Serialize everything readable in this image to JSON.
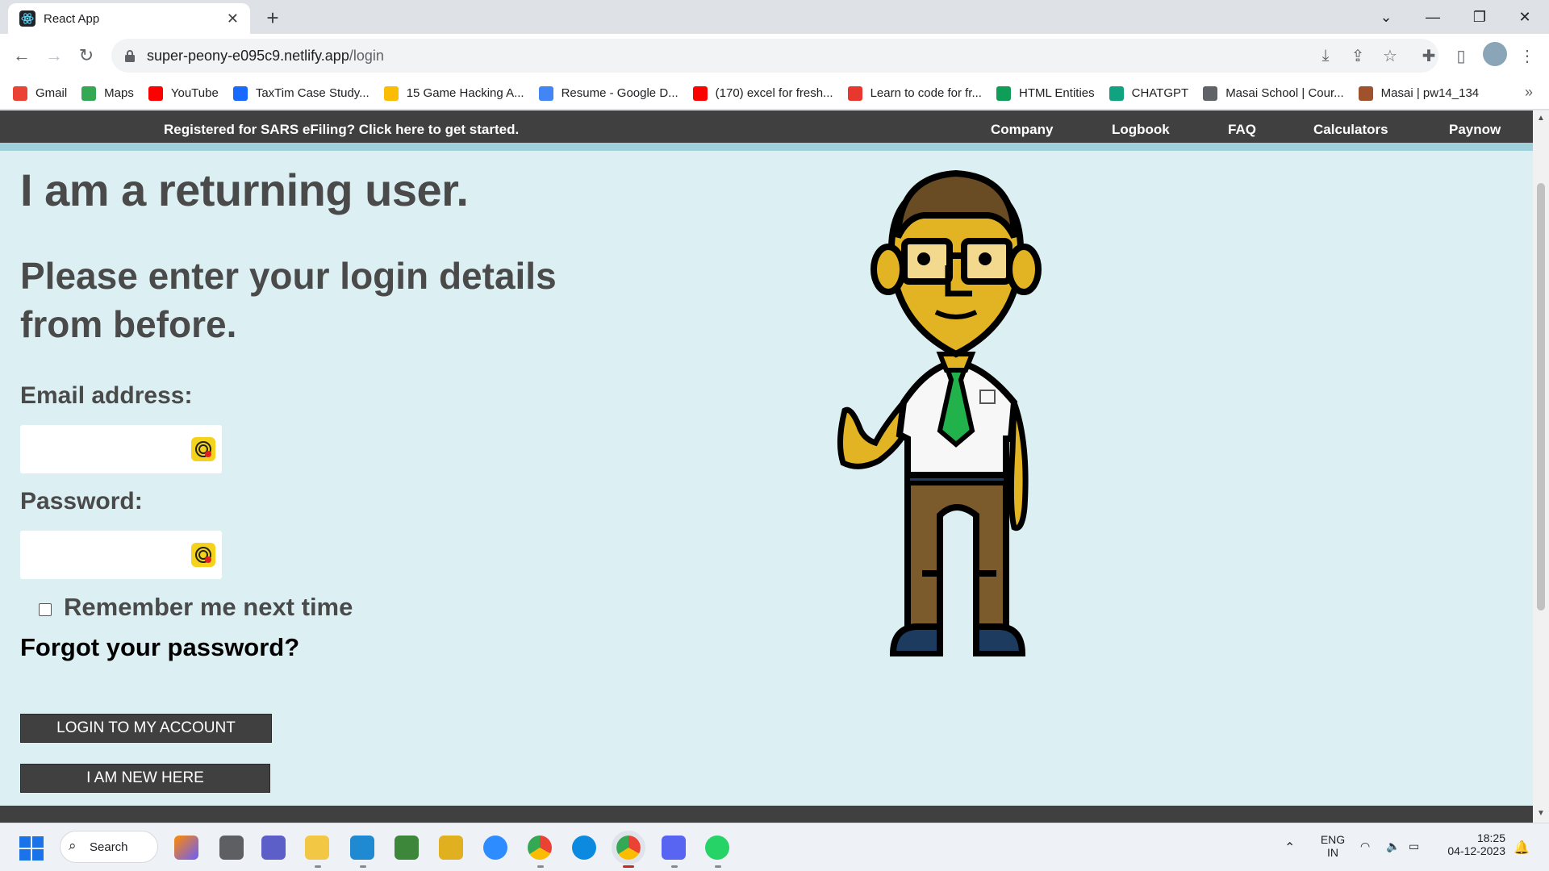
{
  "browser": {
    "tab_title": "React App",
    "url_host": "super-peony-e095c9.netlify.app",
    "url_path": "/login",
    "bookmarks": [
      {
        "label": "Gmail",
        "icon": "gmail-icon",
        "color": "#ea4335"
      },
      {
        "label": "Maps",
        "icon": "maps-icon",
        "color": "#34a853"
      },
      {
        "label": "YouTube",
        "icon": "youtube-icon",
        "color": "#ff0000"
      },
      {
        "label": "TaxTim Case Study...",
        "icon": "behance-icon",
        "color": "#1769ff"
      },
      {
        "label": "15 Game Hacking A...",
        "icon": "drive-icon",
        "color": "#fbbc04"
      },
      {
        "label": "Resume - Google D...",
        "icon": "docs-icon",
        "color": "#4285f4"
      },
      {
        "label": "(170) excel for fresh...",
        "icon": "youtube-icon",
        "color": "#ff0000"
      },
      {
        "label": "Learn to code for fr...",
        "icon": "codecademy-icon",
        "color": "#e8372e"
      },
      {
        "label": "HTML Entities",
        "icon": "w3-icon",
        "color": "#0f9d58"
      },
      {
        "label": "CHATGPT",
        "icon": "openai-icon",
        "color": "#10a37f"
      },
      {
        "label": "Masai School | Cour...",
        "icon": "globe-icon",
        "color": "#5f6368"
      },
      {
        "label": "Masai | pw14_134",
        "icon": "pin-icon",
        "color": "#a0522d"
      }
    ]
  },
  "site": {
    "promo": "Registered for SARS eFiling? Click here to get started.",
    "nav": [
      "Company",
      "Logbook",
      "FAQ",
      "Calculators",
      "Paynow"
    ]
  },
  "login": {
    "heading": "I am a returning user.",
    "subheading": "Please enter your login details from before.",
    "email_label": "Email address:",
    "email_value": "",
    "password_label": "Password:",
    "password_value": "",
    "remember_label": "Remember me next time",
    "remember_checked": false,
    "forgot_label": "Forgot your password?",
    "login_button": "LOGIN TO MY ACCOUNT",
    "new_button": "I AM NEW HERE"
  },
  "taskbar": {
    "search_label": "Search",
    "lang_top": "ENG",
    "lang_bottom": "IN",
    "time": "18:25",
    "date": "04-12-2023"
  },
  "colors": {
    "page_bg": "#dcf0f4",
    "dark_bar": "#404041",
    "accent_stripe": "#9fd0dc",
    "heading_text": "#4a4a4a"
  }
}
